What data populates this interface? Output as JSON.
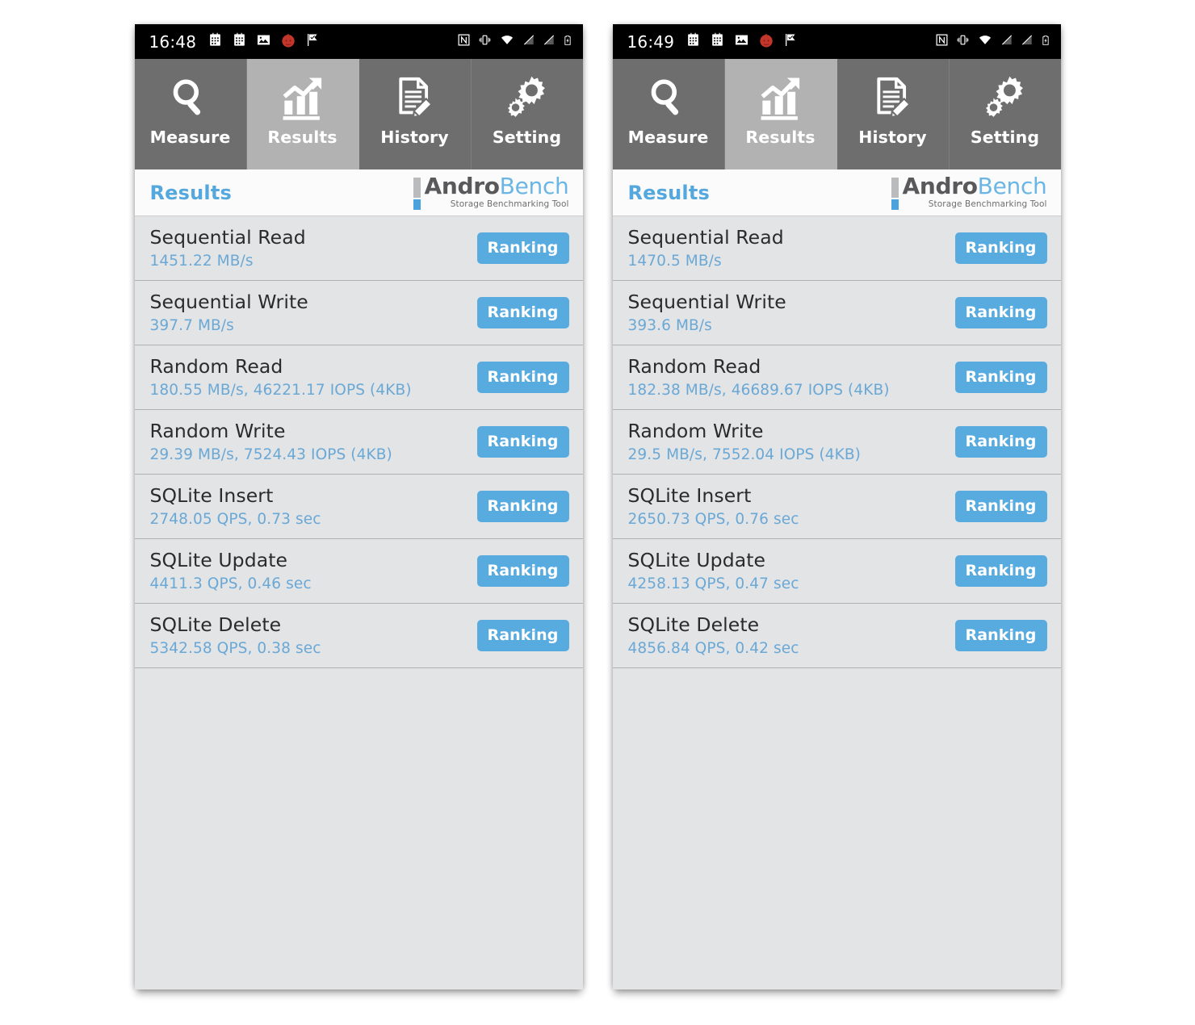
{
  "panels": [
    {
      "id": "left",
      "statusbar": {
        "time": "16:48",
        "left_icons": [
          "calendar-icon",
          "calendar-icon",
          "image-icon",
          "app-red-icon",
          "flag-check-icon"
        ],
        "right_icons": [
          "nfc-icon",
          "vibrate-icon",
          "wifi-icon",
          "signal-off-icon",
          "signal-off-icon",
          "battery-charging-icon"
        ]
      },
      "tabs": [
        {
          "label": "Measure",
          "icon": "magnifier-icon",
          "active": false
        },
        {
          "label": "Results",
          "icon": "bar-chart-arrow-icon",
          "active": true
        },
        {
          "label": "History",
          "icon": "document-pen-icon",
          "active": false
        },
        {
          "label": "Setting",
          "icon": "gears-icon",
          "active": false
        }
      ],
      "header": {
        "title": "Results",
        "logo_primary": "Andro",
        "logo_secondary": "Bench",
        "logo_tagline": "Storage Benchmarking Tool"
      },
      "rows": [
        {
          "title": "Sequential Read",
          "value": "1451.22 MB/s",
          "button": "Ranking"
        },
        {
          "title": "Sequential Write",
          "value": "397.7 MB/s",
          "button": "Ranking"
        },
        {
          "title": "Random Read",
          "value": "180.55 MB/s, 46221.17 IOPS (4KB)",
          "button": "Ranking"
        },
        {
          "title": "Random Write",
          "value": "29.39 MB/s, 7524.43 IOPS (4KB)",
          "button": "Ranking"
        },
        {
          "title": "SQLite Insert",
          "value": "2748.05 QPS, 0.73 sec",
          "button": "Ranking"
        },
        {
          "title": "SQLite Update",
          "value": "4411.3 QPS, 0.46 sec",
          "button": "Ranking"
        },
        {
          "title": "SQLite Delete",
          "value": "5342.58 QPS, 0.38 sec",
          "button": "Ranking"
        }
      ]
    },
    {
      "id": "right",
      "statusbar": {
        "time": "16:49",
        "left_icons": [
          "calendar-icon",
          "calendar-icon",
          "image-icon",
          "app-red-icon",
          "flag-check-icon"
        ],
        "right_icons": [
          "nfc-icon",
          "vibrate-icon",
          "wifi-icon",
          "signal-off-icon",
          "signal-off-icon",
          "battery-charging-icon"
        ]
      },
      "tabs": [
        {
          "label": "Measure",
          "icon": "magnifier-icon",
          "active": false
        },
        {
          "label": "Results",
          "icon": "bar-chart-arrow-icon",
          "active": true
        },
        {
          "label": "History",
          "icon": "document-pen-icon",
          "active": false
        },
        {
          "label": "Setting",
          "icon": "gears-icon",
          "active": false
        }
      ],
      "header": {
        "title": "Results",
        "logo_primary": "Andro",
        "logo_secondary": "Bench",
        "logo_tagline": "Storage Benchmarking Tool"
      },
      "rows": [
        {
          "title": "Sequential Read",
          "value": "1470.5 MB/s",
          "button": "Ranking"
        },
        {
          "title": "Sequential Write",
          "value": "393.6 MB/s",
          "button": "Ranking"
        },
        {
          "title": "Random Read",
          "value": "182.38 MB/s, 46689.67 IOPS (4KB)",
          "button": "Ranking"
        },
        {
          "title": "Random Write",
          "value": "29.5 MB/s, 7552.04 IOPS (4KB)",
          "button": "Ranking"
        },
        {
          "title": "SQLite Insert",
          "value": "2650.73 QPS, 0.76 sec",
          "button": "Ranking"
        },
        {
          "title": "SQLite Update",
          "value": "4258.13 QPS, 0.47 sec",
          "button": "Ranking"
        },
        {
          "title": "SQLite Delete",
          "value": "4856.84 QPS, 0.42 sec",
          "button": "Ranking"
        }
      ]
    }
  ],
  "colors": {
    "accent_blue": "#58abde",
    "value_blue": "#6aa8d6",
    "tab_inactive": "#6e6e6e",
    "tab_active": "#b2b2b2",
    "panel_bg": "#e3e4e6",
    "statusbar_bg": "#000000"
  }
}
